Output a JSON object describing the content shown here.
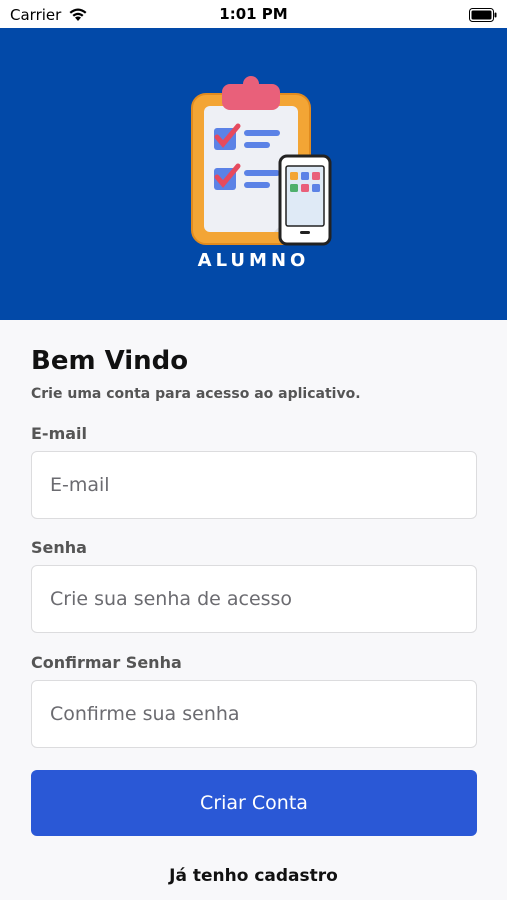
{
  "status_bar": {
    "carrier": "Carrier",
    "time": "1:01 PM"
  },
  "header": {
    "brand": "ALUMNO",
    "background": "#0249a8"
  },
  "form": {
    "title": "Bem Vindo",
    "subtitle": "Crie uma conta para acesso ao aplicativo.",
    "email": {
      "label": "E-mail",
      "placeholder": "E-mail"
    },
    "password": {
      "label": "Senha",
      "placeholder": "Crie sua senha de acesso"
    },
    "confirm": {
      "label": "Confirmar Senha",
      "placeholder": "Confirme sua senha"
    },
    "submit_label": "Criar Conta",
    "login_link": "Já tenho cadastro"
  },
  "colors": {
    "accent": "#2a58d6"
  }
}
